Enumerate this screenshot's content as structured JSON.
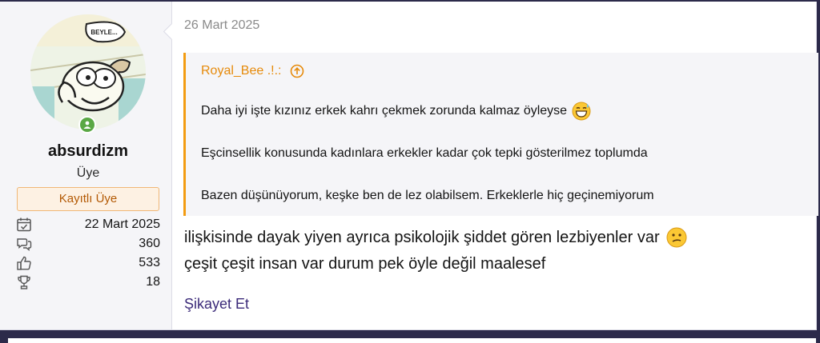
{
  "post": {
    "user": {
      "username": "absurdizm",
      "role": "Üye",
      "badge": "Kayıtlı Üye",
      "avatar_caption": "BEYLE...",
      "online": true
    },
    "stats": [
      {
        "icon": "calendar-check-icon",
        "value": "22 Mart 2025"
      },
      {
        "icon": "messages-icon",
        "value": "360"
      },
      {
        "icon": "thumbs-up-icon",
        "value": "533"
      },
      {
        "icon": "trophy-icon",
        "value": "18"
      }
    ],
    "date": "26 Mart 2025",
    "quote": {
      "author": "Royal_Bee .!.:",
      "lines": [
        "Daha iyi işte kızınız erkek kahrı çekmek zorunda kalmaz öyleyse",
        "Eşcinsellik konusunda kadınlara erkekler kadar çok tepki gösterilmez toplumda",
        "Bazen düşünüyorum, keşke ben de lez olabilsem. Erkeklerle hiç geçinemiyorum"
      ]
    },
    "message": {
      "lines": [
        "ilişkisinde dayak yiyen ayrıca psikolojik şiddet gören lezbiyenler var",
        "çeşit çeşit insan var durum pek öyle değil maalesef"
      ]
    },
    "report_label": "Şikayet Et"
  },
  "colors": {
    "accent_orange": "#f39c12",
    "link_purple": "#3b2a79",
    "online_green": "#5aa845"
  }
}
